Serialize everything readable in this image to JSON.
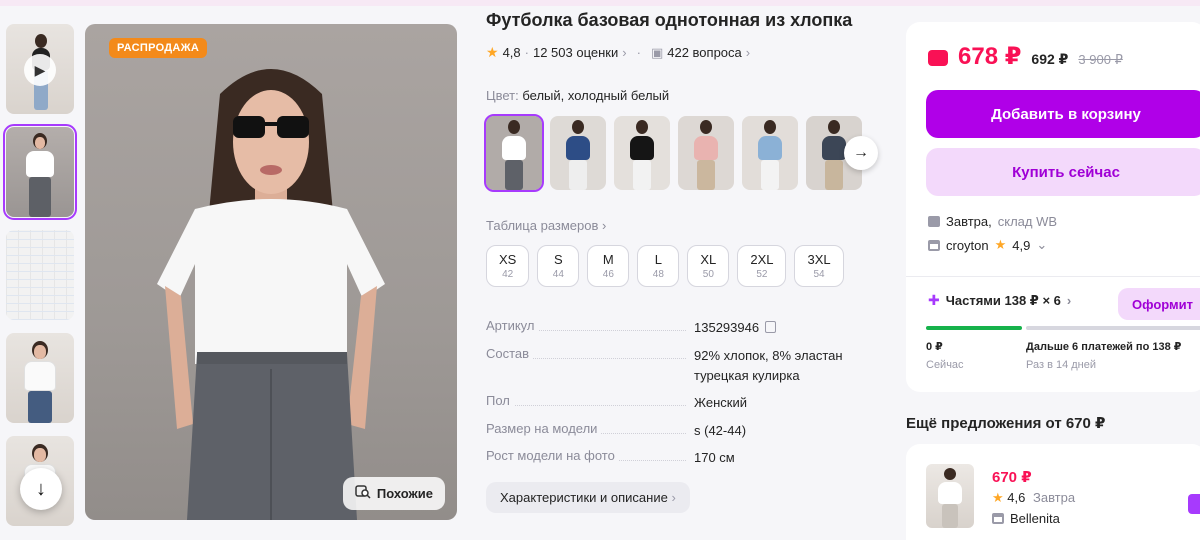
{
  "badge": "РАСПРОДАЖА",
  "similar_label": "Похожие",
  "product": {
    "title": "Футболка базовая однотонная из хлопка",
    "rating": "4,8",
    "reviews": "12 503 оценки",
    "questions": "422 вопроса",
    "color_label": "Цвет:",
    "color_value": "белый, холодный белый"
  },
  "size_table_label": "Таблица размеров",
  "sizes": [
    {
      "label": "XS",
      "num": "42"
    },
    {
      "label": "S",
      "num": "44"
    },
    {
      "label": "M",
      "num": "46"
    },
    {
      "label": "L",
      "num": "48"
    },
    {
      "label": "XL",
      "num": "50"
    },
    {
      "label": "2XL",
      "num": "52"
    },
    {
      "label": "3XL",
      "num": "54"
    }
  ],
  "specs": [
    {
      "key": "Артикул",
      "value": "135293946"
    },
    {
      "key": "Состав",
      "value": "92% хлопок, 8% эластан",
      "value2": "турецкая кулирка"
    },
    {
      "key": "Пол",
      "value": "Женский"
    },
    {
      "key": "Размер на модели",
      "value": "s (42-44)"
    },
    {
      "key": "Рост модели на фото",
      "value": "170 см"
    }
  ],
  "desc_button": "Характеристики и описание",
  "buy": {
    "price": "678 ₽",
    "price_alt": "692 ₽",
    "price_old": "3 900 ₽",
    "add_to_cart": "Добавить в корзину",
    "buy_now": "Купить сейчас",
    "delivery_day": "Завтра,",
    "delivery_place": "склад WB",
    "seller_name": "croyton",
    "seller_rating": "4,9",
    "installment": "Частями 138 ₽ × 6",
    "installment_btn": "Оформит",
    "pay_now_amount": "0 ₽",
    "pay_now_label": "Сейчас",
    "pay_next_amount": "Дальше 6 платежей по 138 ₽",
    "pay_next_label": "Раз в 14 дней"
  },
  "more_offers_title": "Ещё предложения от 670 ₽",
  "offer": {
    "price": "670 ₽",
    "rating": "4,6",
    "delivery": "Завтра",
    "seller": "Bellenita"
  },
  "colors": {
    "accent": "#a73afd",
    "button": "#b000e8",
    "price": "#f91155",
    "badge": "#f38a1a"
  }
}
